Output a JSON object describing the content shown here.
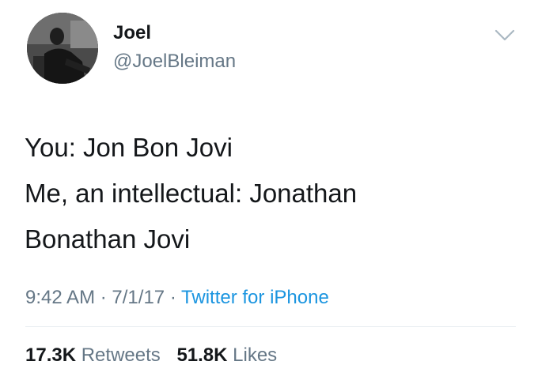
{
  "user": {
    "display_name": "Joel",
    "handle": "@JoelBleiman",
    "avatar_icon": "profile-photo"
  },
  "tweet": {
    "lines": [
      "You: Jon Bon Jovi",
      "Me, an intellectual: Jonathan",
      "Bonathan Jovi"
    ],
    "time": "9:42 AM",
    "date": "7/1/17",
    "separator": "·",
    "source": "Twitter for iPhone"
  },
  "stats": {
    "retweets_count": "17.3K",
    "retweets_label": "Retweets",
    "likes_count": "51.8K",
    "likes_label": "Likes"
  },
  "icons": {
    "menu": "chevron-down-icon"
  },
  "colors": {
    "text": "#14171a",
    "secondary": "#657786",
    "link": "#1b95e0",
    "divider": "#e6ecf0"
  }
}
